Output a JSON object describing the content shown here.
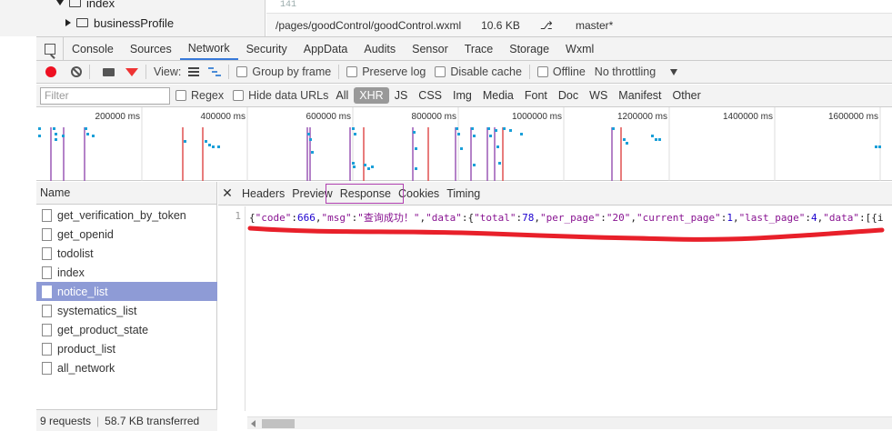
{
  "tree": {
    "folder_index": "index",
    "folder_businessProfile": "businessProfile"
  },
  "editor": {
    "line_number": "141",
    "file_path": "/pages/goodControl/goodControl.wxml",
    "file_size": "10.6 KB",
    "branch": "master*"
  },
  "devtools_tabs": [
    "Console",
    "Sources",
    "Network",
    "Security",
    "AppData",
    "Audits",
    "Sensor",
    "Trace",
    "Storage",
    "Wxml"
  ],
  "active_tab": "Network",
  "network_toolbar": {
    "view_label": "View:",
    "group_by_frame": "Group by frame",
    "preserve_log": "Preserve log",
    "disable_cache": "Disable cache",
    "offline": "Offline",
    "throttling": "No throttling"
  },
  "filter_bar": {
    "placeholder": "Filter",
    "regex": "Regex",
    "hide_data_urls": "Hide data URLs",
    "types": [
      "All",
      "XHR",
      "JS",
      "CSS",
      "Img",
      "Media",
      "Font",
      "Doc",
      "WS",
      "Manifest",
      "Other"
    ],
    "active_type": "XHR"
  },
  "overview": {
    "ticks": [
      "200000 ms",
      "400000 ms",
      "600000 ms",
      "800000 ms",
      "1000000 ms",
      "1200000 ms",
      "1400000 ms",
      "1600000 ms"
    ],
    "line_colors": {
      "purple": "#9b59b6",
      "red": "#e05050",
      "bar": "#1a9fd8"
    }
  },
  "request_list": {
    "header": "Name",
    "items": [
      "get_verification_by_token",
      "get_openid",
      "todolist",
      "index",
      "notice_list",
      "systematics_list",
      "get_product_state",
      "product_list",
      "all_network"
    ],
    "selected": "notice_list",
    "footer_requests": "9 requests",
    "footer_transferred": "58.7 KB transferred"
  },
  "detail": {
    "tabs": [
      "Headers",
      "Preview",
      "Response",
      "Cookies",
      "Timing"
    ],
    "active_tab": "Response",
    "gutter": "1",
    "response_text": "{\"code\":666,\"msg\":\"查询成功！\",\"data\":{\"total\":78,\"per_page\":\"20\",\"current_page\":1,\"last_page\":4,\"data\":[{\"i"
  },
  "colors": {
    "accent_blue": "#3879d9",
    "selected_row": "#8e9bd6",
    "annotation_red": "#e8202a",
    "response_highlight": "#b040b0"
  }
}
